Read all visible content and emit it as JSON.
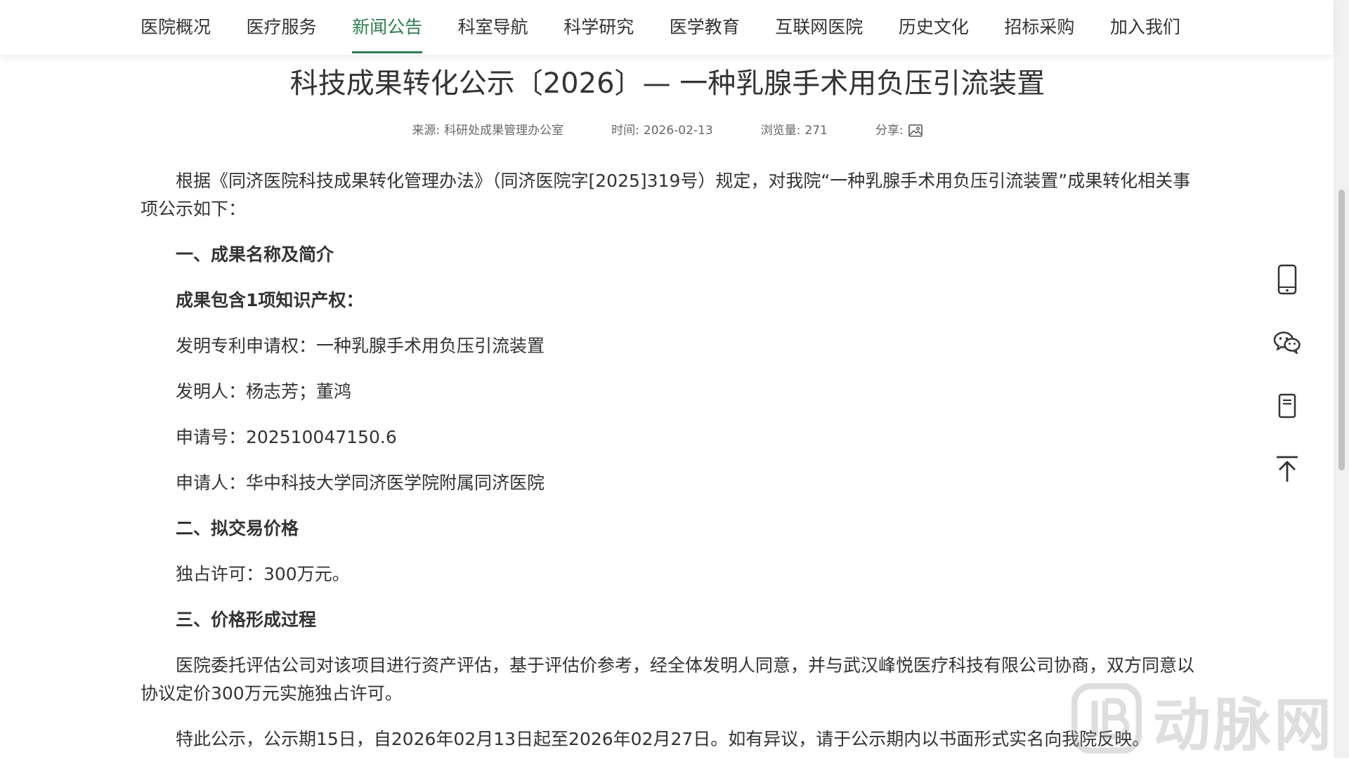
{
  "nav": {
    "items": [
      {
        "label": "医院概况"
      },
      {
        "label": "医疗服务"
      },
      {
        "label": "新闻公告",
        "active": true
      },
      {
        "label": "科室导航"
      },
      {
        "label": "科学研究"
      },
      {
        "label": "医学教育"
      },
      {
        "label": "互联网医院"
      },
      {
        "label": "历史文化"
      },
      {
        "label": "招标采购"
      },
      {
        "label": "加入我们"
      }
    ],
    "active_color": "#2e7d4f"
  },
  "article": {
    "title": "科技成果转化公示〔2026〕— 一种乳腺手术用负压引流装置",
    "meta": {
      "source_label": "来源:",
      "source": "科研处成果管理办公室",
      "time_label": "时间:",
      "time": "2026-02-13",
      "views_label": "浏览量:",
      "views": "271",
      "share_label": "分享:",
      "share_icon": "image-icon"
    },
    "paragraphs": [
      {
        "text": "根据《同济医院科技成果转化管理办法》（同济医院字[2025]319号）规定，对我院“一种乳腺手术用负压引流装置”成果转化相关事项公示如下：",
        "bold": false
      },
      {
        "text": "一、成果名称及简介",
        "bold": true
      },
      {
        "text": "成果包含1项知识产权：",
        "bold": true
      },
      {
        "text": "发明专利申请权：一种乳腺手术用负压引流装置",
        "bold": false
      },
      {
        "text": "发明人：杨志芳；董鸿",
        "bold": false
      },
      {
        "text": "申请号：202510047150.6",
        "bold": false
      },
      {
        "text": "申请人：华中科技大学同济医学院附属同济医院",
        "bold": false
      },
      {
        "text": "二、拟交易价格",
        "bold": true
      },
      {
        "text": "独占许可：300万元。",
        "bold": false
      },
      {
        "text": "三、价格形成过程",
        "bold": true
      },
      {
        "text": "医院委托评估公司对该项目进行资产评估，基于评估价参考，经全体发明人同意，并与武汉峰悦医疗科技有限公司协商，双方同意以协议定价300万元实施独占许可。",
        "bold": false
      },
      {
        "text": "特此公示，公示期15日，自2026年02月13日起至2026年02月27日。如有异议，请于公示期内以书面形式实名向我院反映。",
        "bold": false
      }
    ]
  },
  "side_tools": [
    {
      "icon": "mobile-phone-icon"
    },
    {
      "icon": "wechat-icon"
    },
    {
      "icon": "bookmark-icon"
    },
    {
      "icon": "back-to-top-icon"
    }
  ],
  "watermark": {
    "text": "动脉网"
  }
}
